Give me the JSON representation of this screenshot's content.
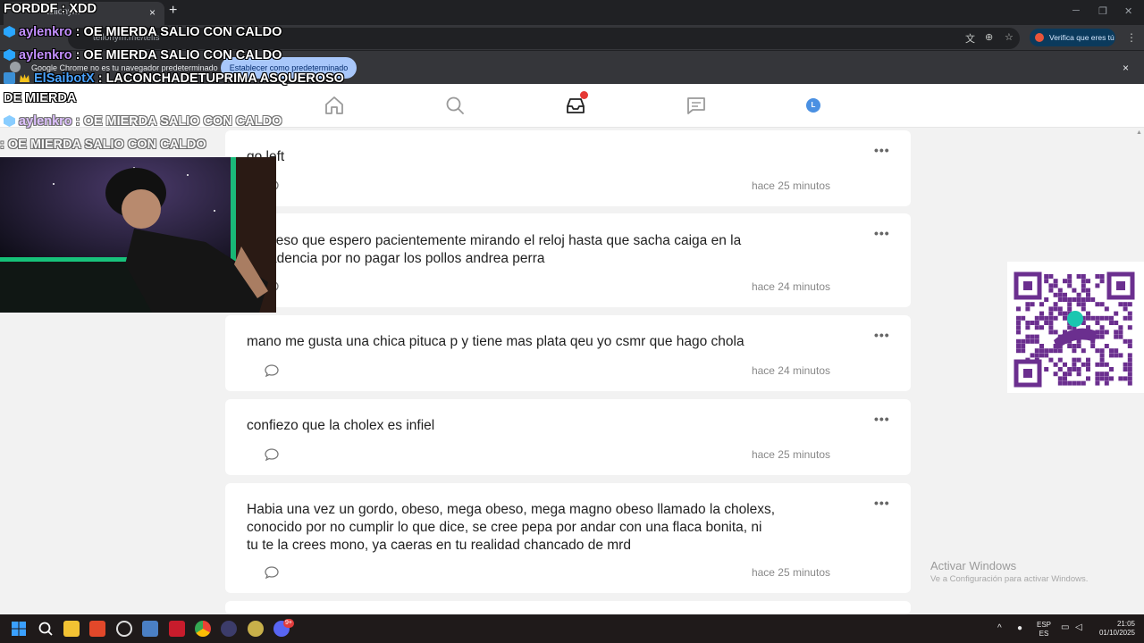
{
  "browser": {
    "tab_title": "tellonym",
    "new_tab": "+",
    "close": "×",
    "url": "tellonym.me/tells",
    "verify_label": "Verifica que eres tú",
    "infobar_text": "Google Chrome no es tu navegador predeterminado",
    "infobar_button": "Establecer como predeterminado"
  },
  "header": {
    "avatar_initial": "L"
  },
  "feed": [
    {
      "text": "go left",
      "time": "hace 25 minutos"
    },
    {
      "text": "confieso que espero pacientemente mirando el reloj hasta que sacha caiga en la\ndecadencia por no pagar los pollos andrea perra",
      "time": "hace 24 minutos"
    },
    {
      "text": "mano me gusta una chica pituca p y tiene mas plata qeu yo csmr que hago chola",
      "time": "hace 24 minutos"
    },
    {
      "text": "confiezo que la cholex es infiel",
      "time": "hace 25 minutos"
    },
    {
      "text": "Habia una vez un gordo, obeso, mega obeso, mega magno obeso llamado la cholexs,\nconocido por no cumplir lo que dice, se cree pepa por andar con una flaca bonita, ni\ntu te la crees mono, ya caeras en tu realidad chancado de mrd",
      "time": "hace 25 minutos"
    }
  ],
  "more_label": "•••",
  "chat": [
    {
      "user": "FORDDF",
      "sep": " : ",
      "msg": "XDD"
    },
    {
      "user": "aylenkro",
      "sep": " : ",
      "msg": "OE MIERDA SALIO CON CALDO"
    },
    {
      "user": "aylenkro",
      "sep": " : ",
      "msg": "OE MIERDA SALIO CON CALDO"
    },
    {
      "user": "ElSaibotX",
      "sep": " : ",
      "msg": "LACONCHADETUPRIMA ASQUEROSO"
    },
    {
      "user": "",
      "sep": "",
      "msg": "DE MIERDA"
    },
    {
      "user": "aylenkro",
      "sep": " : ",
      "msg": "OE MIERDA SALIO CON CALDO"
    },
    {
      "user": "",
      "sep": "",
      "msg": ": OE MIERDA SALIO CON CALDO"
    }
  ],
  "watermark": {
    "title": "Activar Windows",
    "subtitle": "Ve a Configuración para activar Windows."
  },
  "taskbar": {
    "lang_top": "ESP",
    "lang_bottom": "ES",
    "time": "21:05",
    "date": "01/10/2025",
    "discord_badge": "9+"
  },
  "colors": {
    "chat_purple": "#c490ff",
    "chat_blue": "#4aa3ff",
    "notif": "#e53935",
    "avatar": "#4a90e2"
  }
}
